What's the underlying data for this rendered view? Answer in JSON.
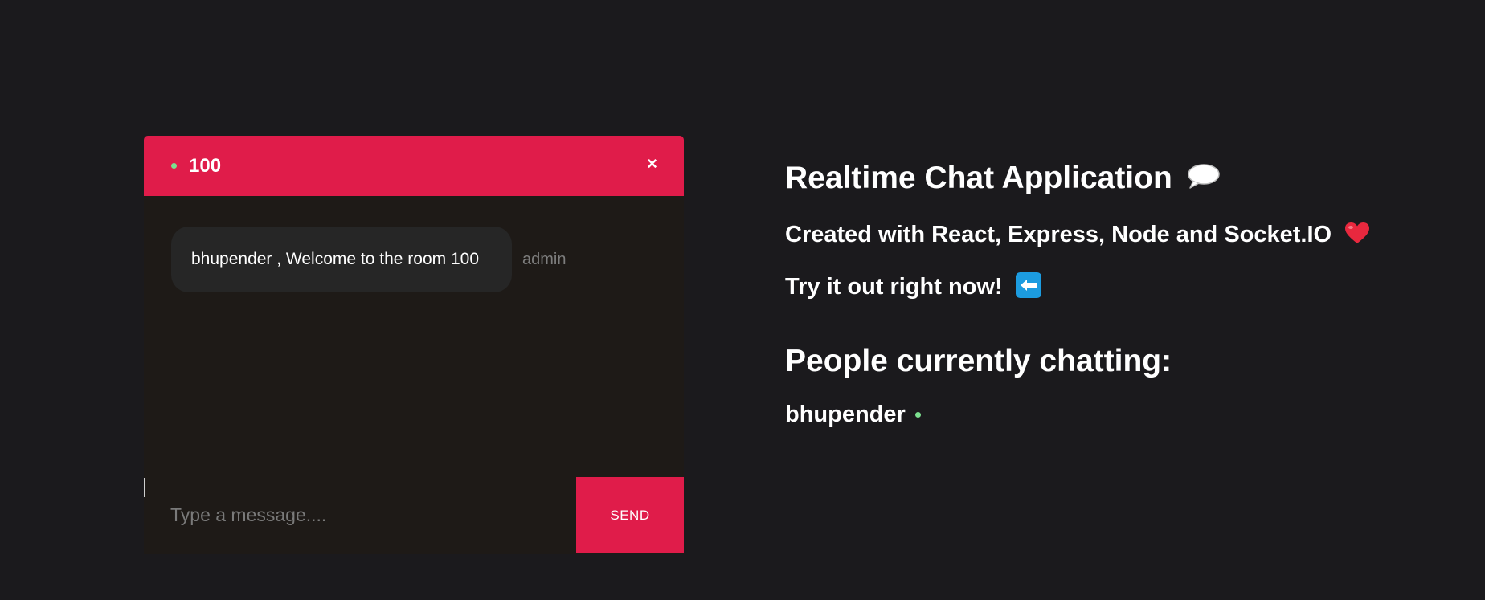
{
  "chat": {
    "room": "100",
    "close_label": "×",
    "messages": [
      {
        "text": "bhupender , Welcome to the room 100",
        "sender": "admin"
      }
    ],
    "input_placeholder": "Type a message....",
    "input_value": "",
    "send_label": "SEND"
  },
  "info": {
    "title": "Realtime Chat Application",
    "title_icon": "speech-bubble-icon",
    "subtitle": "Created with React, Express, Node and Socket.IO",
    "subtitle_icon": "heart-icon",
    "try_text": "Try it out right now!",
    "try_icon": "left-arrow-icon",
    "people_heading": "People currently chatting:",
    "users": [
      {
        "name": "bhupender",
        "status": "online"
      }
    ]
  },
  "colors": {
    "background": "#1b1a1d",
    "accent": "#e01c4a",
    "online": "#7ce08f",
    "chat_body": "#1e1a17",
    "bubble": "#262626"
  }
}
